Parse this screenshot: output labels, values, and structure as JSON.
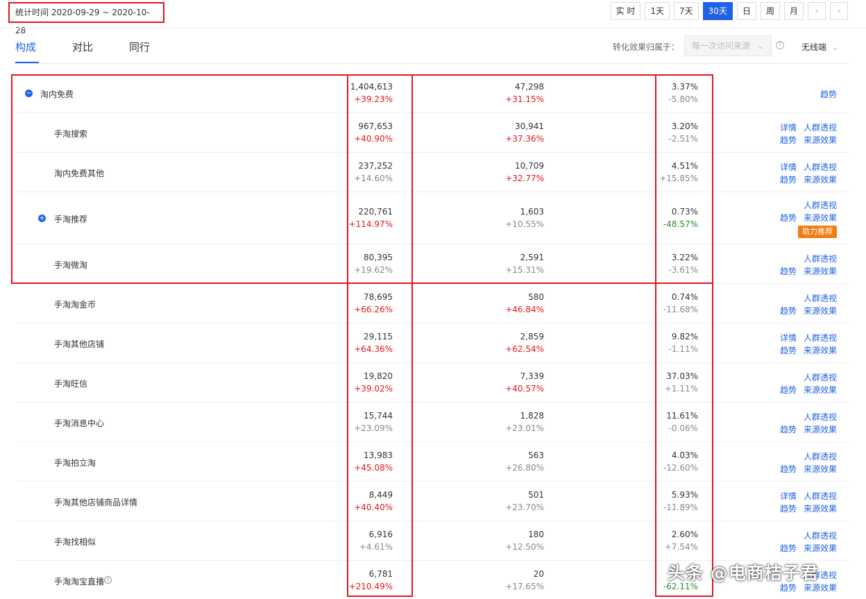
{
  "date_range": "统计时间 2020-09-29 ~ 2020-10-28",
  "periods": [
    {
      "label": "实 时",
      "active": false
    },
    {
      "label": "1天",
      "active": false
    },
    {
      "label": "7天",
      "active": false
    },
    {
      "label": "30天",
      "active": true
    },
    {
      "label": "日",
      "active": false
    },
    {
      "label": "周",
      "active": false
    },
    {
      "label": "月",
      "active": false
    }
  ],
  "nav": {
    "prev": "‹",
    "next": "›"
  },
  "tabs": [
    "构成",
    "对比",
    "同行"
  ],
  "attribution": {
    "label": "转化效果归属于：",
    "placeholder": "每一次访问来源"
  },
  "device": "无线端",
  "rows": [
    {
      "name": "淘内免费",
      "v1": "1,404,613",
      "c1": "+39.23%",
      "v2": "47,298",
      "c2": "+31.15%",
      "v3": "3.37%",
      "c3": "-5.80%",
      "ops": [
        [
          "趋势"
        ]
      ]
    },
    {
      "name": "手淘搜索",
      "v1": "967,653",
      "c1": "+40.90%",
      "v2": "30,941",
      "c2": "+37.36%",
      "v3": "3.20%",
      "c3": "-2.51%",
      "ops": [
        [
          "详情",
          "人群透视"
        ],
        [
          "趋势",
          "来源效果"
        ]
      ]
    },
    {
      "name": "淘内免费其他",
      "v1": "237,252",
      "c1": "+14.60%",
      "v2": "10,709",
      "c2": "+32.77%",
      "v3": "4.51%",
      "c3": "+15.85%",
      "ops": [
        [
          "详情",
          "人群透视"
        ],
        [
          "趋势",
          "来源效果"
        ]
      ]
    },
    {
      "name": "手淘推荐",
      "v1": "220,761",
      "c1": "+114.97%",
      "v2": "1,603",
      "c2": "+10.55%",
      "v3": "0.73%",
      "c3": "-48.57%",
      "ops": [
        [
          "人群透视"
        ],
        [
          "趋势",
          "来源效果"
        ]
      ],
      "tag": "助力推荐"
    },
    {
      "name": "手淘微淘",
      "v1": "80,395",
      "c1": "+19.62%",
      "v2": "2,591",
      "c2": "+15.31%",
      "v3": "3.22%",
      "c3": "-3.61%",
      "ops": [
        [
          "人群透视"
        ],
        [
          "趋势",
          "来源效果"
        ]
      ]
    },
    {
      "name": "手淘淘金币",
      "v1": "78,695",
      "c1": "+66.26%",
      "v2": "580",
      "c2": "+46.84%",
      "v3": "0.74%",
      "c3": "-11.68%",
      "ops": [
        [
          "人群透视"
        ],
        [
          "趋势",
          "来源效果"
        ]
      ]
    },
    {
      "name": "手淘其他店铺",
      "v1": "29,115",
      "c1": "+64.36%",
      "v2": "2,859",
      "c2": "+62.54%",
      "v3": "9.82%",
      "c3": "-1.11%",
      "ops": [
        [
          "详情",
          "人群透视"
        ],
        [
          "趋势",
          "来源效果"
        ]
      ]
    },
    {
      "name": "手淘旺信",
      "v1": "19,820",
      "c1": "+39.02%",
      "v2": "7,339",
      "c2": "+40.57%",
      "v3": "37.03%",
      "c3": "+1.11%",
      "ops": [
        [
          "人群透视"
        ],
        [
          "趋势",
          "来源效果"
        ]
      ]
    },
    {
      "name": "手淘消息中心",
      "v1": "15,744",
      "c1": "+23.09%",
      "v2": "1,828",
      "c2": "+23.01%",
      "v3": "11.61%",
      "c3": "-0.06%",
      "ops": [
        [
          "人群透视"
        ],
        [
          "趋势",
          "来源效果"
        ]
      ]
    },
    {
      "name": "手淘拍立淘",
      "v1": "13,983",
      "c1": "+45.08%",
      "v2": "563",
      "c2": "+26.80%",
      "v3": "4.03%",
      "c3": "-12.60%",
      "ops": [
        [
          "人群透视"
        ],
        [
          "趋势",
          "来源效果"
        ]
      ]
    },
    {
      "name": "手淘其他店铺商品详情",
      "v1": "8,449",
      "c1": "+40.40%",
      "v2": "501",
      "c2": "+23.70%",
      "v3": "5.93%",
      "c3": "-11.89%",
      "ops": [
        [
          "详情",
          "人群透视"
        ],
        [
          "趋势",
          "来源效果"
        ]
      ]
    },
    {
      "name": "手淘找相似",
      "v1": "6,916",
      "c1": "+4.61%",
      "v2": "180",
      "c2": "+12.50%",
      "v3": "2.60%",
      "c3": "+7.54%",
      "ops": [
        [
          "人群透视"
        ],
        [
          "趋势",
          "来源效果"
        ]
      ]
    },
    {
      "name": "手淘淘宝直播",
      "v1": "6,781",
      "c1": "+210.49%",
      "v2": "20",
      "c2": "+17.65%",
      "v3": "",
      "c3": "-62.11%",
      "ops": [
        [
          "人群透视"
        ],
        [
          "趋势",
          "来源效果"
        ]
      ]
    }
  ],
  "watermark": "头条 @电商桔子君"
}
